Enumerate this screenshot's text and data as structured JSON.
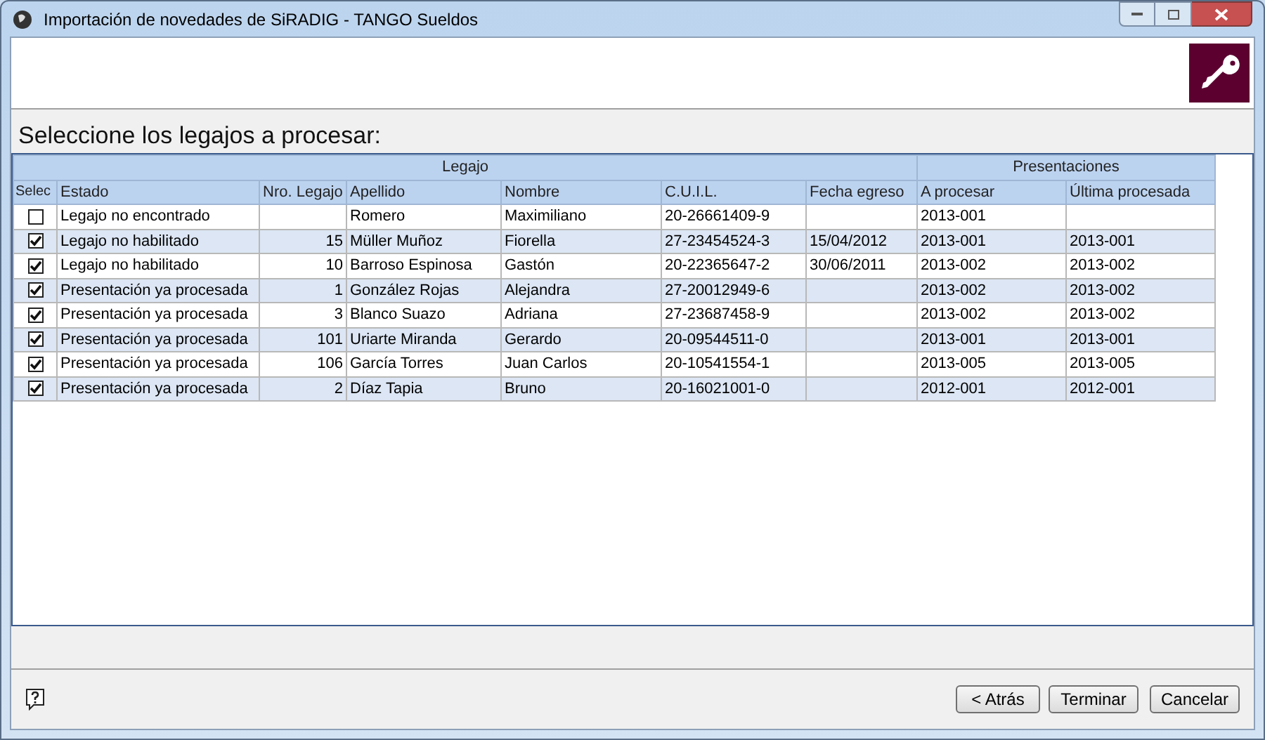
{
  "window": {
    "title": "Importación de novedades de SiRADIG - TANGO Sueldos"
  },
  "heading": "Seleccione los legajos a procesar:",
  "table": {
    "groups": [
      {
        "label": "Legajo"
      },
      {
        "label": "Presentaciones"
      }
    ],
    "select_column": "Selec",
    "columns": [
      "Estado",
      "Nro. Legajo",
      "Apellido",
      "Nombre",
      "C.U.I.L.",
      "Fecha egreso",
      "A procesar",
      "Última procesada"
    ],
    "rows": [
      {
        "checked": false,
        "cells": [
          "Legajo no encontrado",
          "",
          "Romero",
          "Maximiliano",
          "20-26661409-9",
          "",
          "2013-001",
          ""
        ]
      },
      {
        "checked": true,
        "cells": [
          "Legajo no habilitado",
          "15",
          "Müller Muñoz",
          "Fiorella",
          "27-23454524-3",
          "15/04/2012",
          "2013-001",
          "2013-001"
        ]
      },
      {
        "checked": true,
        "cells": [
          "Legajo no habilitado",
          "10",
          "Barroso Espinosa",
          "Gastón",
          "20-22365647-2",
          "30/06/2011",
          "2013-002",
          "2013-002"
        ]
      },
      {
        "checked": true,
        "cells": [
          "Presentación ya procesada",
          "1",
          "González Rojas",
          "Alejandra",
          "27-20012949-6",
          "",
          "2013-002",
          "2013-002"
        ]
      },
      {
        "checked": true,
        "cells": [
          "Presentación ya procesada",
          "3",
          "Blanco Suazo",
          "Adriana",
          "27-23687458-9",
          "",
          "2013-002",
          "2013-002"
        ]
      },
      {
        "checked": true,
        "cells": [
          "Presentación ya procesada",
          "101",
          "Uriarte Miranda",
          "Gerardo",
          "20-09544511-0",
          "",
          "2013-001",
          "2013-001"
        ]
      },
      {
        "checked": true,
        "cells": [
          "Presentación ya procesada",
          "106",
          "García Torres",
          "Juan Carlos",
          "20-10541554-1",
          "",
          "2013-005",
          "2013-005"
        ]
      },
      {
        "checked": true,
        "cells": [
          "Presentación ya procesada",
          "2",
          "Díaz Tapia",
          "Bruno",
          "20-16021001-0",
          "",
          "2012-001",
          "2012-001"
        ]
      }
    ]
  },
  "buttons": [
    "< Atrás",
    "Terminar",
    "Cancelar"
  ]
}
